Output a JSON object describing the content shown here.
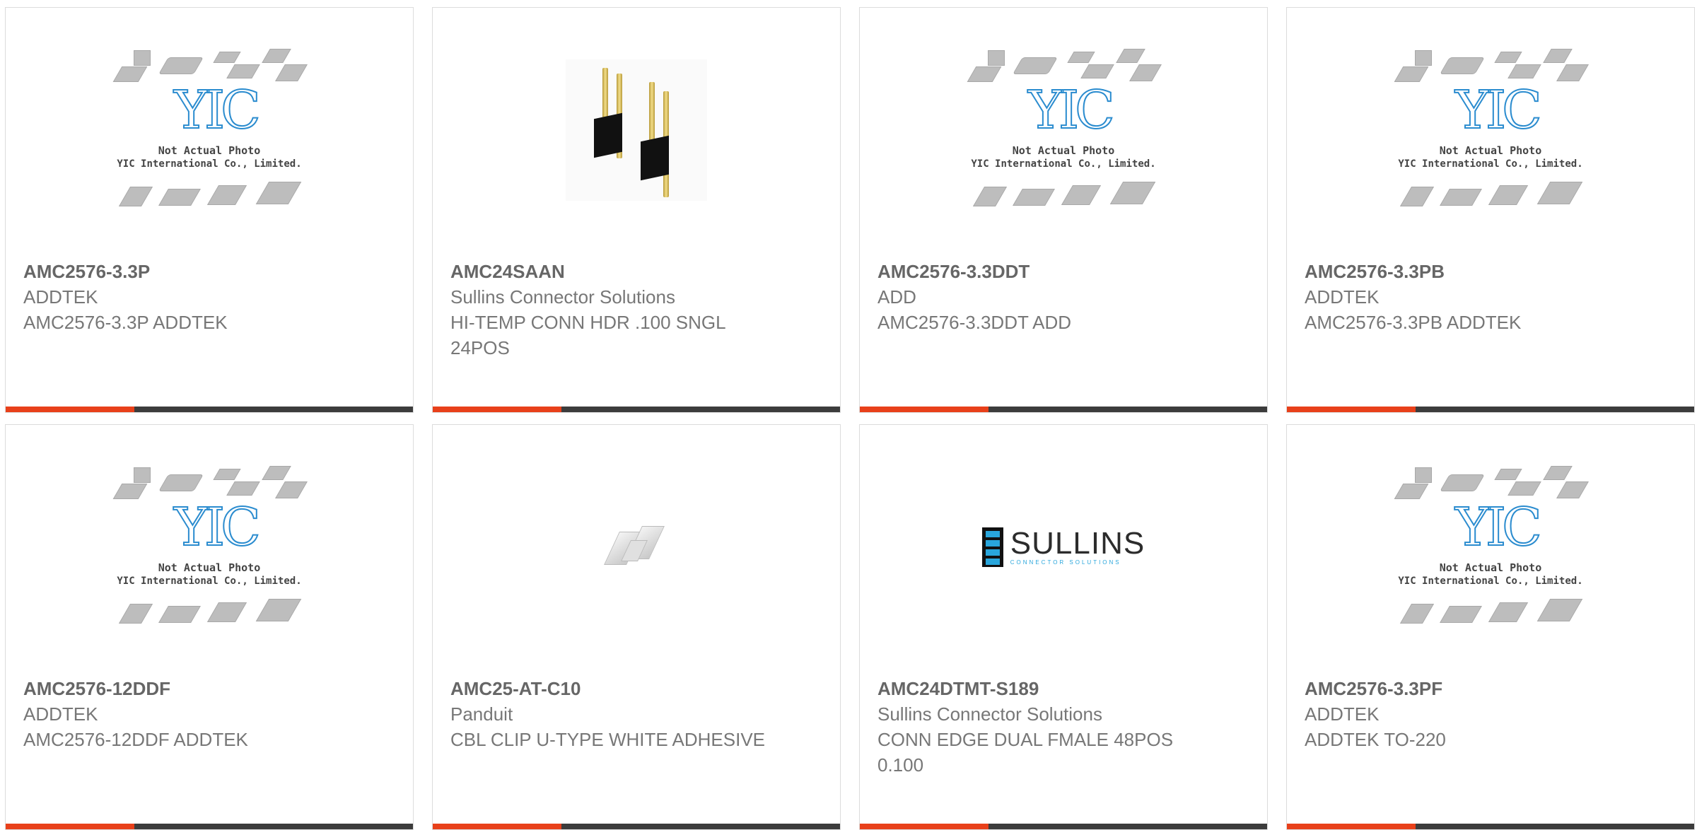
{
  "products": [
    {
      "part": "AMC2576-3.3P",
      "manufacturer": "ADDTEK",
      "description": "AMC2576-3.3P ADDTEK",
      "image": "yic-placeholder"
    },
    {
      "part": "AMC24SAAN",
      "manufacturer": "Sullins Connector Solutions",
      "description": "HI-TEMP CONN HDR .100 SNGL 24POS",
      "image": "pin-header-photo"
    },
    {
      "part": "AMC2576-3.3DDT",
      "manufacturer": "ADD",
      "description": "AMC2576-3.3DDT ADD",
      "image": "yic-placeholder"
    },
    {
      "part": "AMC2576-3.3PB",
      "manufacturer": "ADDTEK",
      "description": "AMC2576-3.3PB ADDTEK",
      "image": "yic-placeholder"
    },
    {
      "part": "AMC2576-12DDF",
      "manufacturer": "ADDTEK",
      "description": "AMC2576-12DDF ADDTEK",
      "image": "yic-placeholder"
    },
    {
      "part": "AMC25-AT-C10",
      "manufacturer": "Panduit",
      "description": "CBL CLIP U-TYPE WHITE ADHESIVE",
      "image": "cable-clip-photo"
    },
    {
      "part": "AMC24DTMT-S189",
      "manufacturer": "Sullins Connector Solutions",
      "description": "CONN EDGE DUAL FMALE 48POS 0.100",
      "image": "sullins-logo"
    },
    {
      "part": "AMC2576-3.3PF",
      "manufacturer": "ADDTEK",
      "description": "ADDTEK TO-220",
      "image": "yic-placeholder"
    }
  ],
  "placeholder": {
    "logo_text": "YIC",
    "line1": "Not Actual Photo",
    "line2": "YIC International Co., Limited."
  },
  "sullins_logo": {
    "word": "SULLINS",
    "sub": "CONNECTOR SOLUTIONS"
  },
  "colors": {
    "accent": "#e8401a",
    "bar": "#3c3c3c",
    "placeholder_logo": "#2b8ccf",
    "sullins_blue": "#29a6dc"
  }
}
